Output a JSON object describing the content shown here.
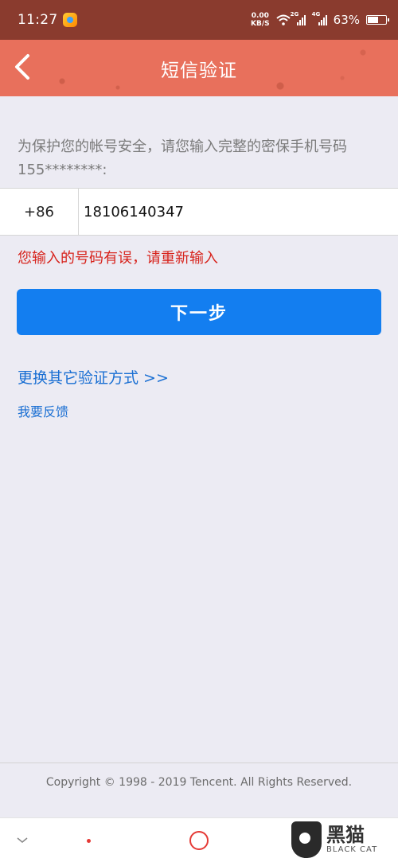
{
  "status_bar": {
    "time": "11:27",
    "net_speed_value": "0.00",
    "net_speed_unit": "KB/S",
    "signal1_tag": "2G",
    "signal2_tag": "4G",
    "battery_text": "63%",
    "battery_level": 0.63
  },
  "header": {
    "title": "短信验证",
    "back_icon": "chevron-left-icon",
    "color": "#e8705c"
  },
  "main": {
    "prompt": "为保护您的帐号安全，请您输入完整的密保手机号码155********:",
    "country_code": "+86",
    "phone_value": "18106140347",
    "error": "您输入的号码有误，请重新输入",
    "next_button": "下一步",
    "switch_link": "更换其它验证方式 >>",
    "feedback_link": "我要反馈",
    "accent_color": "#137ef0",
    "error_color": "#d7231c"
  },
  "footer": {
    "copyright": "Copyright © 1998 - 2019 Tencent. All Rights Reserved."
  },
  "nav": {
    "items": [
      "chevron-down-icon",
      "dot-icon",
      "circle-icon",
      "dot-icon"
    ]
  },
  "watermark": {
    "cn": "黑猫",
    "en": "BLACK CAT"
  }
}
